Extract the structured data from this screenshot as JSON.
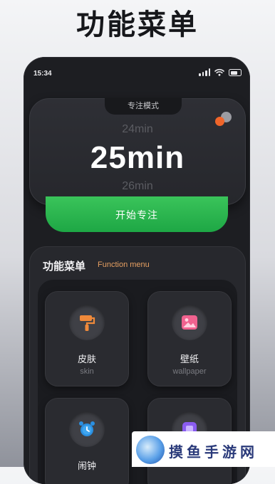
{
  "headline": "功能菜单",
  "status_bar": {
    "time": "15:34",
    "icons": [
      "signal-icon",
      "wifi-icon",
      "battery-icon"
    ]
  },
  "timer": {
    "mode_label": "专注模式",
    "prev_value": "24min",
    "current_value": "25min",
    "next_value": "26min",
    "start_label": "开始专注"
  },
  "menu": {
    "title": "功能菜单",
    "subtitle": "Function menu",
    "items": [
      {
        "label": "皮肤",
        "sub": "skin",
        "icon": "paint-roller-icon"
      },
      {
        "label": "壁纸",
        "sub": "wallpaper",
        "icon": "image-icon"
      },
      {
        "label": "闹钟",
        "sub": "",
        "icon": "alarm-clock-icon"
      },
      {
        "label": "",
        "sub": "",
        "icon": "app-icon"
      }
    ]
  },
  "watermark": {
    "text": "摸鱼手游网"
  },
  "colors": {
    "accent_green": "#2db84f",
    "accent_orange": "#f0652a",
    "menu_subtitle": "#e7a062"
  }
}
